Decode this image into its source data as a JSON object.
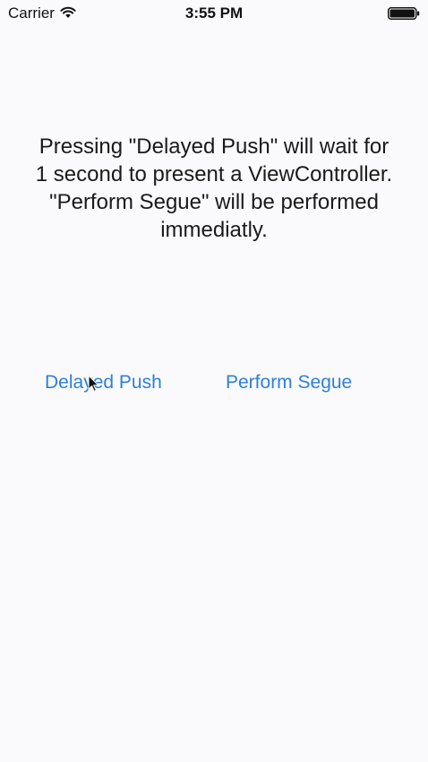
{
  "status_bar": {
    "carrier": "Carrier",
    "time": "3:55 PM",
    "wifi_icon": "wifi-icon",
    "battery_icon": "battery-full-icon"
  },
  "main": {
    "instructions": "Pressing \"Delayed Push\" will wait for\n1 second to present a ViewController.\n\"Perform Segue\" will be performed\nimmediatly.",
    "delayed_push_label": "Delayed Push",
    "perform_segue_label": "Perform Segue"
  },
  "colors": {
    "tint": "#2d7fd9",
    "background": "#fafafd",
    "text": "#1a1a1a"
  },
  "cursor_icon": "arrow-cursor-icon"
}
